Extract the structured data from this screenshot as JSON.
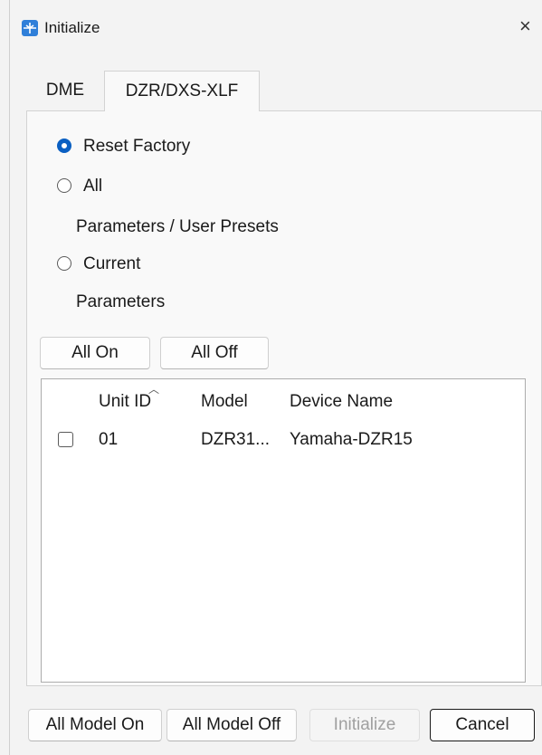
{
  "window": {
    "title": "Initialize",
    "close_glyph": "×"
  },
  "tabs": [
    {
      "label": "DME",
      "active": false
    },
    {
      "label": "DZR/DXS-XLF",
      "active": true
    }
  ],
  "options": {
    "reset_factory": {
      "label": "Reset Factory",
      "selected": true
    },
    "all": {
      "label": "All",
      "description": "Parameters / User Presets",
      "selected": false
    },
    "current": {
      "label": "Current",
      "description": "Parameters",
      "selected": false
    }
  },
  "buttons": {
    "all_on": "All On",
    "all_off": "All Off",
    "all_model_on": "All Model On",
    "all_model_off": "All Model Off",
    "initialize": "Initialize",
    "cancel": "Cancel"
  },
  "table": {
    "columns": [
      "Unit ID",
      "Model",
      "Device Name"
    ],
    "sort_indicator": "︿",
    "rows": [
      {
        "checked": false,
        "unit_id": "01",
        "model": "DZR31...",
        "device_name": "Yamaha-DZR15"
      }
    ]
  },
  "colors": {
    "accent": "#0a5fc2",
    "app_icon": "#2f7fd9"
  },
  "icons": {
    "app": "initialize-app-icon",
    "close": "close-icon"
  }
}
